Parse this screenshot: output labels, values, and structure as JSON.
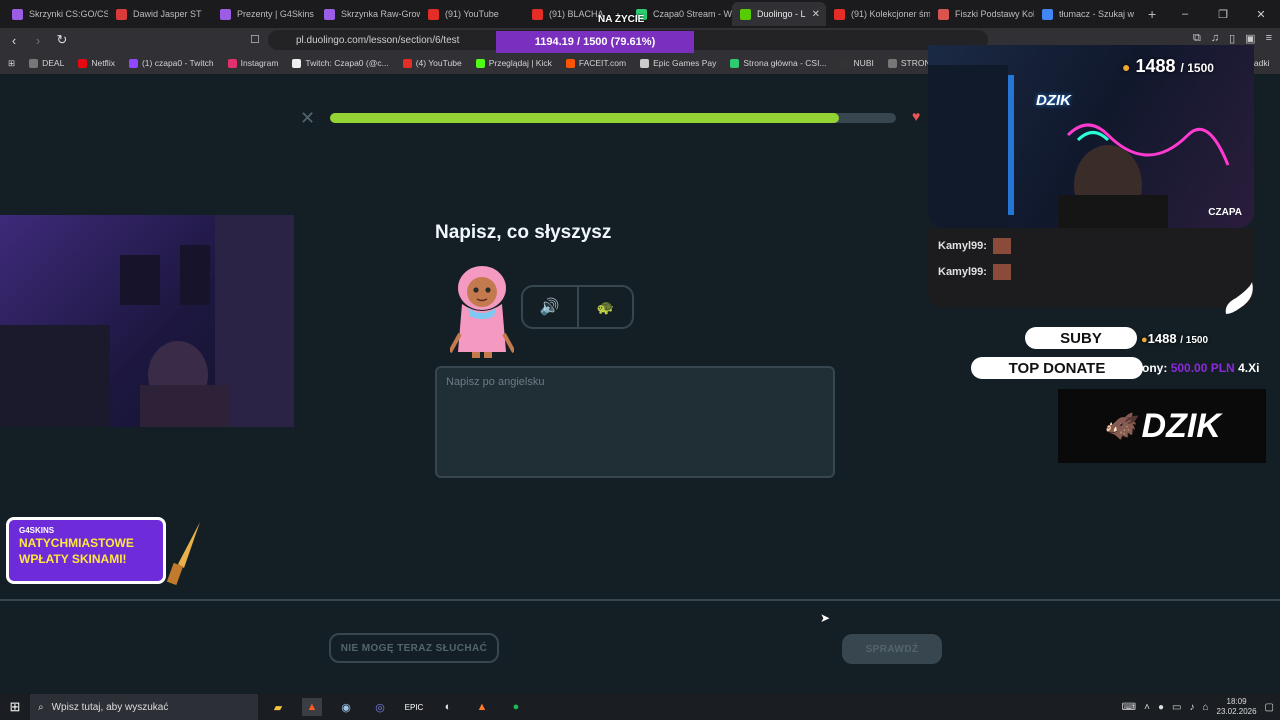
{
  "browser": {
    "tabs": [
      {
        "label": "Skrzynki CS:GO/CS2",
        "color": "#9b5de5"
      },
      {
        "label": "Dawid Jasper ST",
        "color": "#d93b3b"
      },
      {
        "label": "Prezenty | G4Skins",
        "color": "#9b5de5"
      },
      {
        "label": "Skrzynka Raw-Grow",
        "color": "#9b5de5"
      },
      {
        "label": "(91) YouTube",
        "color": "#e52d27"
      },
      {
        "label": "(91) BLACHA",
        "color": "#e52d27"
      },
      {
        "label": "Czapa0 Stream - Wo",
        "color": "#2ecc71"
      },
      {
        "label": "Duolingo - L",
        "color": "#58cc02"
      },
      {
        "label": "(91) Kolekcjoner śm",
        "color": "#e52d27"
      },
      {
        "label": "Fiszki Podstawy Kol",
        "color": "#d9534f"
      },
      {
        "label": "tłumacz - Szukaj w",
        "color": "#4285f4"
      }
    ],
    "active_tab_close": "✕",
    "new_tab": "+",
    "url": "pl.duolingo.com/lesson/section/6/test"
  },
  "bookmarks": [
    {
      "label": "DEAL",
      "color": "#777777"
    },
    {
      "label": "Netflix",
      "color": "#e50914"
    },
    {
      "label": "(1) czapa0 - Twitch",
      "color": "#9146ff"
    },
    {
      "label": "Instagram",
      "color": "#e1306c"
    },
    {
      "label": "Twitch: Czapa0 (@c...",
      "color": "#eeeeee"
    },
    {
      "label": "(4) YouTube",
      "color": "#e52d27"
    },
    {
      "label": "Przeglądaj | Kick",
      "color": "#53fc18"
    },
    {
      "label": "FACEIT.com",
      "color": "#ff5500"
    },
    {
      "label": "Epic Games Pay",
      "color": "#cccccc"
    },
    {
      "label": "Strona główna - CSI...",
      "color": "#2ecc71"
    },
    {
      "label": "NUBI",
      "color": "#333333"
    },
    {
      "label": "STRONY",
      "color": "#777777"
    },
    {
      "label": "Skrzyn",
      "color": "#9b5de5"
    }
  ],
  "bookmarks_tail": "ładki",
  "lesson": {
    "progress": 0.9,
    "title": "Napisz, co słyszysz",
    "answer_placeholder": "Napisz po angielsku",
    "skip_label": "NIE MOGĘ TERAZ SŁUCHAĆ",
    "check_label": "SPRAWDŹ"
  },
  "overlay": {
    "goal_title": "NA ŻYCIE",
    "goal_banner": "1194.19 / 1500 (79.61%)",
    "cam_name": "CZAPA",
    "subs_current": "1488",
    "subs_total": "/ 1500",
    "chat": [
      {
        "user": "Kamyl99:"
      },
      {
        "user": "Kamyl99:"
      }
    ],
    "suby_label": "SUBY",
    "suby_value": "1488",
    "suby_total": "/ 1500",
    "top_donate_label": "TOP DONATE",
    "donor_name": "ony:",
    "donor_amount": "500.00 PLN",
    "donor_next": "4.Xi",
    "brand": "DZIK",
    "promo_brand": "G4SKINS",
    "promo_line1": "NATYCHMIASTOWE",
    "promo_line2": "WPŁATY SKINAMI!"
  },
  "taskbar": {
    "search_placeholder": "Wpisz tutaj, aby wyszukać",
    "time": "18:09",
    "date": "23.02.2026"
  }
}
